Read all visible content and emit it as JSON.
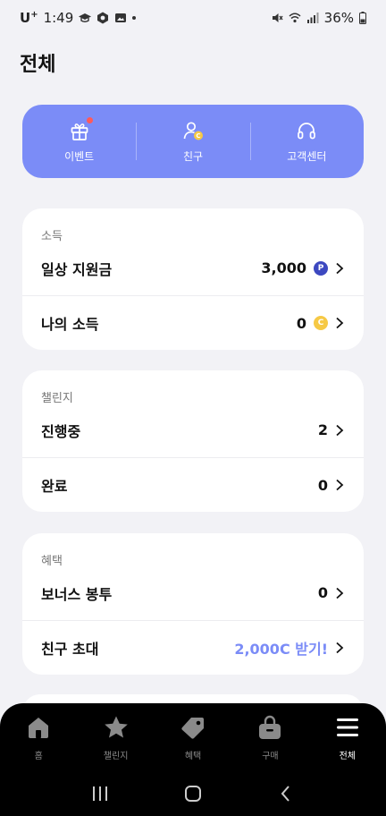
{
  "status_bar": {
    "carrier": "U",
    "carrier_sup": "+",
    "time": "1:49",
    "battery": "36%"
  },
  "page": {
    "title": "전체"
  },
  "quick_menu": [
    {
      "label": "이벤트",
      "icon": "gift-icon",
      "has_badge": true
    },
    {
      "label": "친구",
      "icon": "friend-coin-icon",
      "has_badge": false
    },
    {
      "label": "고객센터",
      "icon": "headset-icon",
      "has_badge": false
    }
  ],
  "income": {
    "header": "소득",
    "rows": [
      {
        "label": "일상 지원금",
        "value": "3,000",
        "coin": "P"
      },
      {
        "label": "나의 소득",
        "value": "0",
        "coin": "C"
      }
    ]
  },
  "challenge": {
    "header": "챌린지",
    "rows": [
      {
        "label": "진행중",
        "value": "2"
      },
      {
        "label": "완료",
        "value": "0"
      }
    ]
  },
  "benefit": {
    "header": "혜택",
    "rows": [
      {
        "label": "보너스 봉투",
        "value": "0"
      },
      {
        "label": "친구 초대",
        "value": "2,000C 받기!"
      }
    ]
  },
  "bottom_nav": [
    {
      "label": "홈",
      "icon": "home-icon"
    },
    {
      "label": "챌린지",
      "icon": "star-icon"
    },
    {
      "label": "혜택",
      "icon": "tag-icon"
    },
    {
      "label": "구매",
      "icon": "shopping-bag-icon"
    },
    {
      "label": "전체",
      "icon": "menu-icon",
      "active": true
    }
  ],
  "colors": {
    "accent": "#7b8cf7",
    "background": "#f2f2f6",
    "point_coin": "#3c48c0",
    "cash_coin": "#f6c945",
    "badge": "#ff5a5a"
  }
}
